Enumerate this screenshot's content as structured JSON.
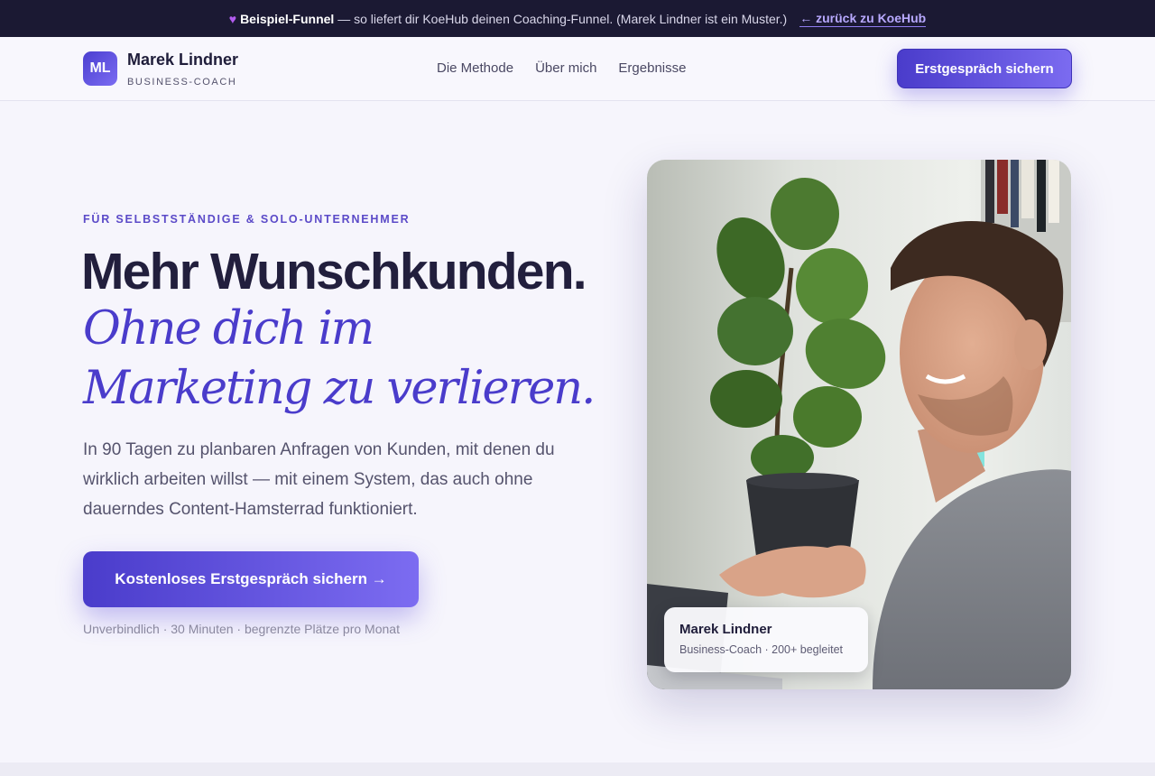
{
  "banner": {
    "highlight": "Beispiel-Funnel",
    "text": "— so liefert dir KoeHub deinen Coaching-Funnel. (Marek Lindner ist ein Muster.)",
    "back_link": "← zurück zu KoeHub"
  },
  "header": {
    "logo_initials": "ML",
    "brand_name": "Marek Lindner",
    "brand_subtitle": "BUSINESS-COACH",
    "nav": [
      "Die Methode",
      "Über mich",
      "Ergebnisse"
    ],
    "cta": "Erstgespräch sichern"
  },
  "hero": {
    "eyebrow": "FÜR SELBSTSTÄNDIGE & SOLO-UNTERNEHMER",
    "headline": "Mehr Wunschkunden.",
    "headline_italic": "Ohne dich im Marketing zu verlieren.",
    "lead": "In 90 Tagen zu planbaren Anfragen von Kunden, mit denen du wirklich arbeiten willst — mit einem System, das auch ohne dauerndes Content-Hamsterrad funktioniert.",
    "cta": "Kostenloses Erstgespräch sichern →",
    "microcopy": "Unverbindlich · 30 Minuten · begrenzte Plätze pro Monat"
  },
  "photo_card": {
    "name": "Marek Lindner",
    "role": "Business-Coach · 200+ begleitet"
  },
  "colors": {
    "accent": "#4a3ccb",
    "accent_light": "#7b6bf0",
    "banner_bg": "#1b1933",
    "page_bg": "#f6f5fc"
  },
  "icons": {
    "banner_icon": "purple-heart-icon"
  }
}
